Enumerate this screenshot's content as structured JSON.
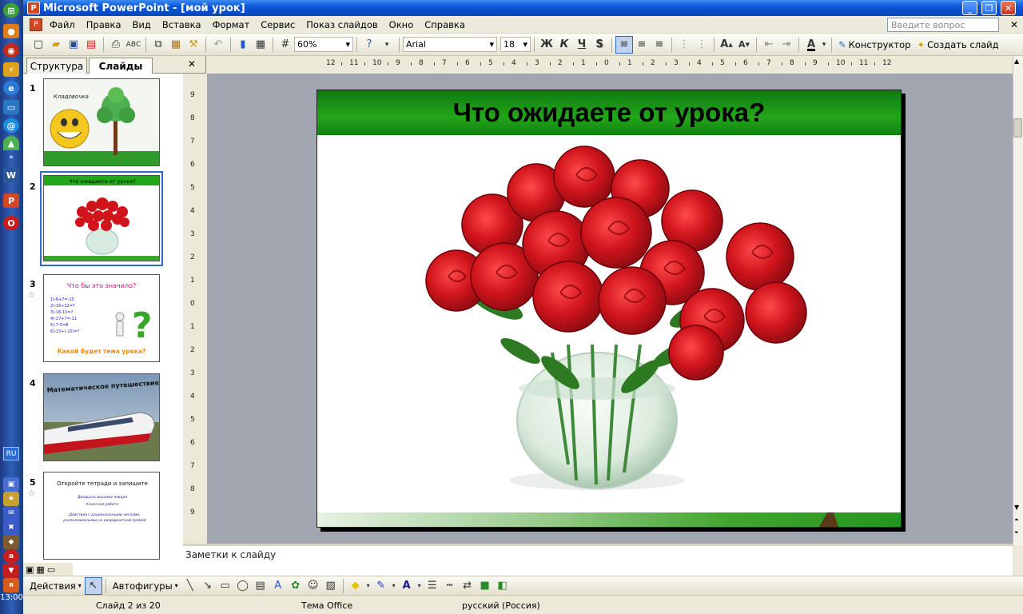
{
  "window": {
    "title": "Microsoft PowerPoint - [мой урок]"
  },
  "menu": [
    "Файл",
    "Правка",
    "Вид",
    "Вставка",
    "Формат",
    "Сервис",
    "Показ слайдов",
    "Окно",
    "Справка"
  ],
  "ask_placeholder": "Введите вопрос",
  "toolbar": {
    "zoom": "60%",
    "font": "Arial",
    "size": "18",
    "bold": "Ж",
    "italic": "К",
    "underline": "Ч",
    "shadow": "S",
    "designer": "Конструктор",
    "new_slide": "Создать слайд"
  },
  "panel": {
    "tab_outline": "Структура",
    "tab_slides": "Слайды",
    "close": "✕"
  },
  "thumbs": [
    {
      "num": "1",
      "label": "Кладовочка"
    },
    {
      "num": "2",
      "label": "Что ожидаете от урока?",
      "selected": true
    },
    {
      "num": "3",
      "title": "Что бы это значило?",
      "lines": [
        "1)-6+7=-15",
        "2)-16+12=?",
        "3)-16-10=?",
        "4)-27+7=-11",
        "5)-7-5=8",
        "6)-15+(-10)=?"
      ],
      "footer": "Какой будет тема урока?"
    },
    {
      "num": "4",
      "label": "Математическое путешествие"
    },
    {
      "num": "5",
      "title": "Откройте тетради и запишите",
      "lines": [
        "Двадцать восьмое января",
        "Классная работа",
        "Действия с рациональными числами, расположенными на координатной прямой"
      ]
    }
  ],
  "ruler_h": [
    "12",
    "11",
    "10",
    "9",
    "8",
    "7",
    "6",
    "5",
    "4",
    "3",
    "2",
    "1",
    "0",
    "1",
    "2",
    "3",
    "4",
    "5",
    "6",
    "7",
    "8",
    "9",
    "10",
    "11",
    "12"
  ],
  "ruler_v": [
    "9",
    "8",
    "7",
    "6",
    "5",
    "4",
    "3",
    "2",
    "1",
    "0",
    "1",
    "2",
    "3",
    "4",
    "5",
    "6",
    "7",
    "8",
    "9"
  ],
  "slide": {
    "title": "Что ожидаете от урока?"
  },
  "notes_placeholder": "Заметки к слайду",
  "draw": {
    "actions": "Действия",
    "autoshapes": "Автофигуры"
  },
  "status": {
    "slide": "Слайд 2 из 20",
    "theme": "Тема Office",
    "lang": "русский (Россия)"
  },
  "taskbar": {
    "lang": "RU",
    "clock": "13:00"
  },
  "colors": {
    "title_bar": "#0a58d8",
    "slide_header": "#23a61a",
    "rose": "#d0141c"
  }
}
